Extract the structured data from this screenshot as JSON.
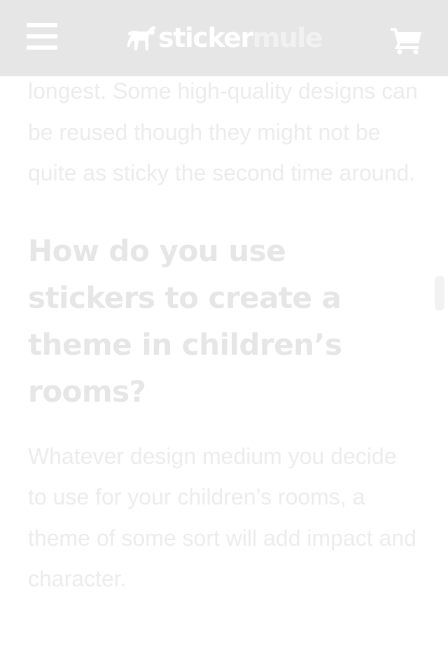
{
  "header": {
    "logo_primary": "sticker",
    "logo_secondary": "mule",
    "icons": {
      "menu": "hamburger-menu-icon",
      "logo": "mule-logo-icon",
      "cart": "shopping-cart-icon"
    }
  },
  "article": {
    "paragraph_top": "longest. Some high-quality designs can be reused though they might not be quite as sticky the second time around.",
    "heading": "How do you use stickers to create a theme in children’s rooms?",
    "paragraph_bottom": "Whatever design medium you decide to use for your children’s rooms, a theme of some sort will add impact and character."
  },
  "colors": {
    "header_background": "#e6e6e6",
    "page_background": "#ffffff",
    "text_faded": "#ececec",
    "heading_faded": "#e6e6e6"
  }
}
